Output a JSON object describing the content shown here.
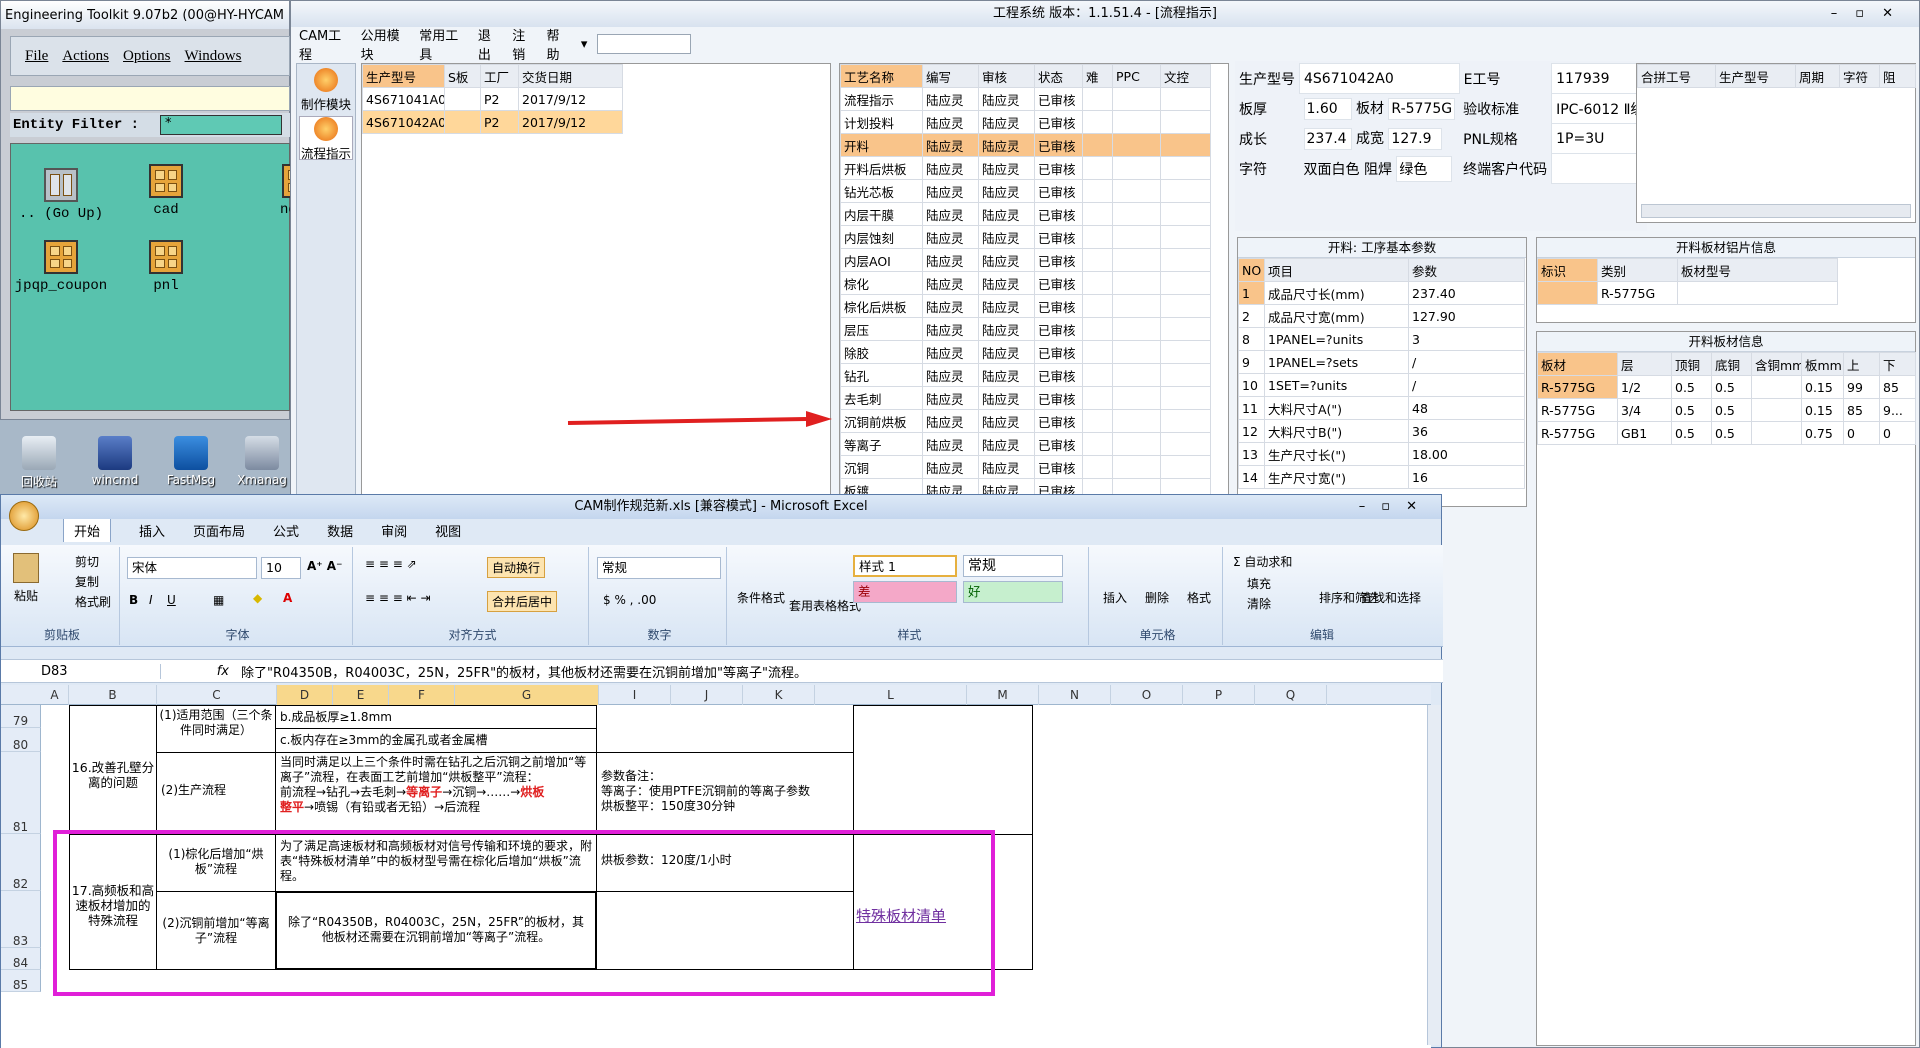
{
  "et": {
    "title": "Engineering Toolkit 9.07b2 (00@HY-HYCAM",
    "menu": [
      "File",
      "Actions",
      "Options",
      "Windows"
    ],
    "filter_label": "Entity Filter :",
    "filter_value": "*",
    "files": [
      "..  (Go Up)",
      "cad",
      "ne",
      "jpqp_coupon",
      "pnl"
    ]
  },
  "desktop": [
    "回收站",
    "wincmd",
    "FastMsg",
    "Xmanag"
  ],
  "es": {
    "title": "工程系统   版本：1.1.51.4 - [流程指示]",
    "menu": [
      "CAM工程",
      "公用模块",
      "常用工具",
      "退出",
      "注销",
      "帮助"
    ],
    "side": [
      "制作模块",
      "流程指示"
    ],
    "orders": {
      "headers": [
        "生产型号",
        "S板",
        "工厂",
        "交货日期"
      ],
      "rows": [
        [
          "4S671041A0",
          "",
          "P2",
          "2017/9/12"
        ],
        [
          "4S671042A0",
          "",
          "P2",
          "2017/9/12"
        ]
      ]
    },
    "process": {
      "headers": [
        "工艺名称",
        "编写",
        "审核",
        "状态",
        "难",
        "PPC",
        "文控"
      ],
      "rows": [
        [
          "流程指示",
          "陆应灵",
          "陆应灵",
          "已审核"
        ],
        [
          "计划投料",
          "陆应灵",
          "陆应灵",
          "已审核"
        ],
        [
          "开料",
          "陆应灵",
          "陆应灵",
          "已审核"
        ],
        [
          "开料后烘板",
          "陆应灵",
          "陆应灵",
          "已审核"
        ],
        [
          "钻光芯板",
          "陆应灵",
          "陆应灵",
          "已审核"
        ],
        [
          "内层干膜",
          "陆应灵",
          "陆应灵",
          "已审核"
        ],
        [
          "内层蚀刻",
          "陆应灵",
          "陆应灵",
          "已审核"
        ],
        [
          "内层AOI",
          "陆应灵",
          "陆应灵",
          "已审核"
        ],
        [
          "棕化",
          "陆应灵",
          "陆应灵",
          "已审核"
        ],
        [
          "棕化后烘板",
          "陆应灵",
          "陆应灵",
          "已审核"
        ],
        [
          "层压",
          "陆应灵",
          "陆应灵",
          "已审核"
        ],
        [
          "除胶",
          "陆应灵",
          "陆应灵",
          "已审核"
        ],
        [
          "钻孔",
          "陆应灵",
          "陆应灵",
          "已审核"
        ],
        [
          "去毛刺",
          "陆应灵",
          "陆应灵",
          "已审核"
        ],
        [
          "沉铜前烘板",
          "陆应灵",
          "陆应灵",
          "已审核"
        ],
        [
          "等离子",
          "陆应灵",
          "陆应灵",
          "已审核"
        ],
        [
          "沉铜",
          "陆应灵",
          "陆应灵",
          "已审核"
        ],
        [
          "板镀",
          "陆应灵",
          "陆应灵",
          "已审核"
        ]
      ]
    },
    "info": {
      "model_label": "生产型号",
      "model": "4S671042A0",
      "e_label": "E工号",
      "e": "117939",
      "thick_label": "板厚",
      "thick": "1.60",
      "mat_label": "板材",
      "mat": "R-5775G",
      "std_label": "验收标准",
      "std": "IPC-6012 Ⅱ级",
      "len_label": "成长",
      "len": "237.4",
      "wid_label": "成宽",
      "wid": "127.9",
      "pnl_label": "PNL规格",
      "pnl": "1P=3U",
      "char_label": "字符",
      "char": "双面白色",
      "mask_label": "阻焊",
      "mask": "绿色",
      "cust_label": "终端客户代码",
      "cust": ""
    },
    "combine": {
      "headers": [
        "合拼工号",
        "生产型号",
        "周期",
        "字符",
        "阻"
      ]
    },
    "basic": {
      "title": "开料: 工序基本参数",
      "headers": [
        "NO",
        "项目",
        "参数"
      ],
      "rows": [
        [
          "1",
          "成品尺寸长(mm)",
          "237.40"
        ],
        [
          "2",
          "成品尺寸宽(mm)",
          "127.90"
        ],
        [
          "8",
          "1PANEL=?units",
          "3"
        ],
        [
          "9",
          "1PANEL=?sets",
          "/"
        ],
        [
          "10",
          "1SET=?units",
          "/"
        ],
        [
          "11",
          "大料尺寸A(\")",
          "48"
        ],
        [
          "12",
          "大料尺寸B(\")",
          "36"
        ],
        [
          "13",
          "生产尺寸长(\")",
          "18.00"
        ],
        [
          "14",
          "生产尺寸宽(\")",
          "16"
        ]
      ]
    },
    "alu": {
      "title": "开料板材铝片信息",
      "headers": [
        "标识",
        "类别",
        "板材型号"
      ],
      "rows": [
        [
          "",
          "R-5775G",
          ""
        ]
      ]
    },
    "board": {
      "title": "开料板材信息",
      "headers": [
        "板材",
        "层",
        "顶铜",
        "底铜",
        "含铜mm",
        "板mm",
        "上",
        "下"
      ],
      "rows": [
        [
          "R-5775G",
          "1/2",
          "0.5",
          "0.5",
          "",
          "0.15",
          "99",
          "85"
        ],
        [
          "R-5775G",
          "3/4",
          "0.5",
          "0.5",
          "",
          "0.15",
          "85",
          "9..."
        ],
        [
          "R-5775G",
          "GB1",
          "0.5",
          "0.5",
          "",
          "0.75",
          "0",
          "0"
        ]
      ]
    }
  },
  "excel": {
    "title": "CAM制作规范新.xls  [兼容模式] - Microsoft Excel",
    "tabs": [
      "开始",
      "插入",
      "页面布局",
      "公式",
      "数据",
      "审阅",
      "视图"
    ],
    "clipboard": {
      "paste": "粘贴",
      "cut": "剪切",
      "copy": "复制",
      "painter": "格式刷",
      "label": "剪贴板"
    },
    "font": {
      "name": "宋体",
      "size": "10",
      "label": "字体"
    },
    "align": {
      "wrap": "自动换行",
      "merge": "合并后居中",
      "label": "对齐方式"
    },
    "number": {
      "format": "常规",
      "label": "数字"
    },
    "styles": {
      "cond": "条件格式",
      "table": "套用表格格式",
      "s1": "样式 1",
      "normal": "常规",
      "bad": "差",
      "good": "好",
      "label": "样式"
    },
    "cells": {
      "insert": "插入",
      "delete": "删除",
      "format": "格式",
      "label": "单元格"
    },
    "edit": {
      "sum": "自动求和",
      "fill": "填充",
      "clear": "清除",
      "sort": "排序和筛选",
      "find": "查找和选择",
      "label": "编辑"
    },
    "namebox": "D83",
    "formula": "除了\"R04350B，R04003C，25N，25FR\"的板材，其他板材还需要在沉铜前增加\"等离子\"流程。",
    "cols": [
      "A",
      "B",
      "C",
      "D",
      "E",
      "F",
      "G",
      "I",
      "J",
      "K",
      "L",
      "M",
      "N",
      "O",
      "P",
      "Q"
    ],
    "rows": [
      "79",
      "80",
      "81",
      "82",
      "83",
      "84",
      "85"
    ],
    "b16": "16.改善孔壁分离的问题",
    "c79": "(1)适用范围（三个条件同时满足）",
    "d79": "b.成品板厚≥1.8mm",
    "d80": "c.板内存在≥3mm的金属孔或者金属槽",
    "c81": "(2)生产流程",
    "d81a": "当同时满足以上三个条件时需在钻孔之后沉铜之前增加“等离子”流程，在表面工艺前增加“烘板整平”流程：",
    "d81b": "前流程→钻孔→去毛刺→",
    "d81c": "等离子",
    "d81d": "→沉铜→……→",
    "d81e": "烘板",
    "d81f": "整平",
    "d81g": "→喷锡（有铅或者无铅）→后流程",
    "i81": "参数备注：\n等离子：使用PTFE沉铜前的等离子参数\n烘板整平：150度30分钟",
    "b17": "17.高频板和高速板材增加的特殊流程",
    "c82": "(1)棕化后增加“烘板”流程",
    "d82": "为了满足高速板材和高频板材对信号传输和环境的要求，附表“特殊板材清单”中的板材型号需在棕化后增加“烘板”流程。",
    "i82": "烘板参数：120度/1小时",
    "c83": "(2)沉铜前增加“等离子”流程",
    "d83": "除了“R04350B，R04003C，25N，25FR”的板材，其他板材还需要在沉铜前增加“等离子”流程。",
    "l83": "特殊板材清单"
  },
  "colors": {
    "accent_red": "#e02020",
    "highlight": "#e020d8",
    "selected": "#f9c48a"
  }
}
